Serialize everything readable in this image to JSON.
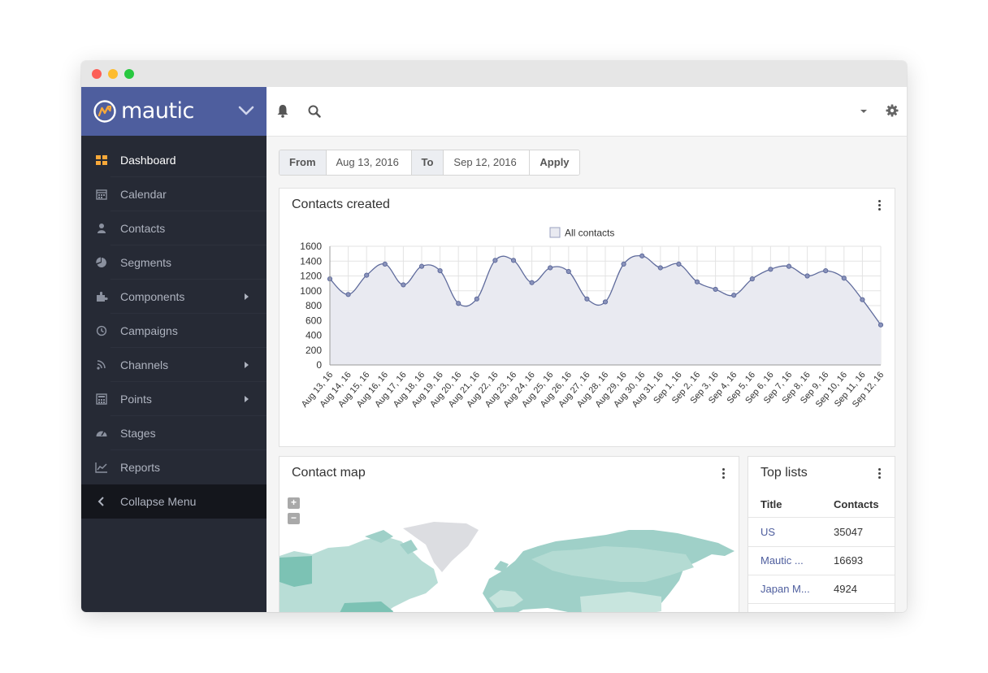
{
  "window": {
    "controls": [
      "close",
      "minimize",
      "maximize"
    ]
  },
  "sidebar": {
    "brand": "mautic",
    "items": [
      {
        "label": "Dashboard",
        "icon": "dashboard-icon",
        "active": true,
        "submenu": false
      },
      {
        "label": "Calendar",
        "icon": "calendar-icon",
        "active": false,
        "submenu": false
      },
      {
        "label": "Contacts",
        "icon": "user-icon",
        "active": false,
        "submenu": false
      },
      {
        "label": "Segments",
        "icon": "pie-chart-icon",
        "active": false,
        "submenu": false
      },
      {
        "label": "Components",
        "icon": "puzzle-icon",
        "active": false,
        "submenu": true
      },
      {
        "label": "Campaigns",
        "icon": "clock-icon",
        "active": false,
        "submenu": false
      },
      {
        "label": "Channels",
        "icon": "rss-icon",
        "active": false,
        "submenu": true
      },
      {
        "label": "Points",
        "icon": "calculator-icon",
        "active": false,
        "submenu": true
      },
      {
        "label": "Stages",
        "icon": "tachometer-icon",
        "active": false,
        "submenu": false
      },
      {
        "label": "Reports",
        "icon": "line-chart-icon",
        "active": false,
        "submenu": false
      }
    ],
    "collapse_label": "Collapse Menu"
  },
  "topbar": {
    "icons": [
      "bell-icon",
      "search-icon",
      "caret-down-icon",
      "gear-icon"
    ]
  },
  "filter": {
    "from_label": "From",
    "from_value": "Aug 13, 2016",
    "to_label": "To",
    "to_value": "Sep 12, 2016",
    "apply_label": "Apply"
  },
  "contacts_panel": {
    "title": "Contacts created"
  },
  "chart_data": {
    "type": "line",
    "title": "Contacts created",
    "legend": [
      "All contacts"
    ],
    "legend_position": "top-center",
    "grid": true,
    "ylim": [
      0,
      1600
    ],
    "yticks": [
      0,
      200,
      400,
      600,
      800,
      1000,
      1200,
      1400,
      1600
    ],
    "x": [
      "Aug 13, 16",
      "Aug 14, 16",
      "Aug 15, 16",
      "Aug 16, 16",
      "Aug 17, 16",
      "Aug 18, 16",
      "Aug 19, 16",
      "Aug 20, 16",
      "Aug 21, 16",
      "Aug 22, 16",
      "Aug 23, 16",
      "Aug 24, 16",
      "Aug 25, 16",
      "Aug 26, 16",
      "Aug 27, 16",
      "Aug 28, 16",
      "Aug 29, 16",
      "Aug 30, 16",
      "Aug 31, 16",
      "Sep 1, 16",
      "Sep 2, 16",
      "Sep 3, 16",
      "Sep 4, 16",
      "Sep 5, 16",
      "Sep 6, 16",
      "Sep 7, 16",
      "Sep 8, 16",
      "Sep 9, 16",
      "Sep 10, 16",
      "Sep 11, 16",
      "Sep 12, 16"
    ],
    "series": [
      {
        "name": "All contacts",
        "color": "#5f6b9c",
        "fill": "#e9eaf1",
        "values": [
          1160,
          950,
          1210,
          1360,
          1080,
          1330,
          1270,
          830,
          890,
          1410,
          1410,
          1110,
          1310,
          1260,
          890,
          850,
          1360,
          1470,
          1310,
          1360,
          1120,
          1020,
          940,
          1160,
          1290,
          1330,
          1200,
          1270,
          1170,
          880,
          540
        ]
      }
    ]
  },
  "map_panel": {
    "title": "Contact map",
    "zoom_in": "+",
    "zoom_out": "−"
  },
  "lists_panel": {
    "title": "Top lists",
    "headers": [
      "Title",
      "Contacts"
    ],
    "rows": [
      {
        "title": "US",
        "count": "35047"
      },
      {
        "title": "Mautic ...",
        "count": "16693"
      },
      {
        "title": "Japan M...",
        "count": "4924"
      }
    ]
  },
  "colors": {
    "brand": "#4e5e9e",
    "sidebar": "#262a35",
    "active_icon": "#f7a839",
    "map_fill": "#9fd0c8"
  }
}
